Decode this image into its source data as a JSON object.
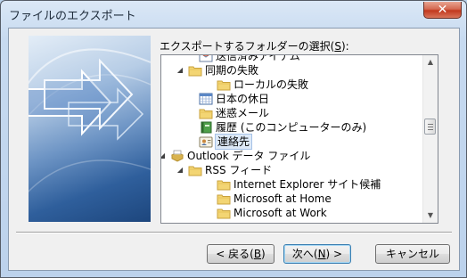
{
  "window": {
    "title": "ファイルのエクスポート",
    "close_glyph": "✕"
  },
  "prompt": {
    "before": "エクスポートするフォルダーの選択(",
    "mnemonic": "S",
    "after": "):"
  },
  "tree": {
    "nodes": [
      {
        "label": "送信済みアイテム",
        "icon": "sent-items-icon",
        "expander": ""
      },
      {
        "label": "同期の失敗",
        "icon": "folder-icon",
        "expander": "◢"
      },
      {
        "label": "ローカルの失敗",
        "icon": "folder-icon",
        "expander": ""
      },
      {
        "label": "日本の休日",
        "icon": "calendar-icon",
        "expander": ""
      },
      {
        "label": "迷惑メール",
        "icon": "folder-icon",
        "expander": ""
      },
      {
        "label": "履歴 (このコンピューターのみ)",
        "icon": "journal-icon",
        "expander": ""
      },
      {
        "label": "連絡先",
        "icon": "contacts-icon",
        "expander": "",
        "selected": true
      },
      {
        "label": "Outlook データ ファイル",
        "icon": "data-file-icon",
        "expander": "◢"
      },
      {
        "label": "RSS フィード",
        "icon": "folder-icon",
        "expander": "◢"
      },
      {
        "label": "Internet Explorer サイト候補",
        "icon": "folder-icon",
        "expander": ""
      },
      {
        "label": "Microsoft at Home",
        "icon": "folder-icon",
        "expander": ""
      },
      {
        "label": "Microsoft at Work",
        "icon": "folder-icon",
        "expander": ""
      }
    ],
    "scroll_up": "▲",
    "scroll_down": "▼"
  },
  "buttons": {
    "back": {
      "before": "< 戻る(",
      "mnemonic": "B",
      "after": ")"
    },
    "next": {
      "before": "次へ(",
      "mnemonic": "N",
      "after": ") >"
    },
    "cancel": "キャンセル"
  },
  "colors": {
    "title_bar": "#c7daf0",
    "close_button": "#c2391f",
    "selection": "#dde9f7",
    "folder": "#f3d573",
    "side_panel": "#2f5f9c"
  }
}
